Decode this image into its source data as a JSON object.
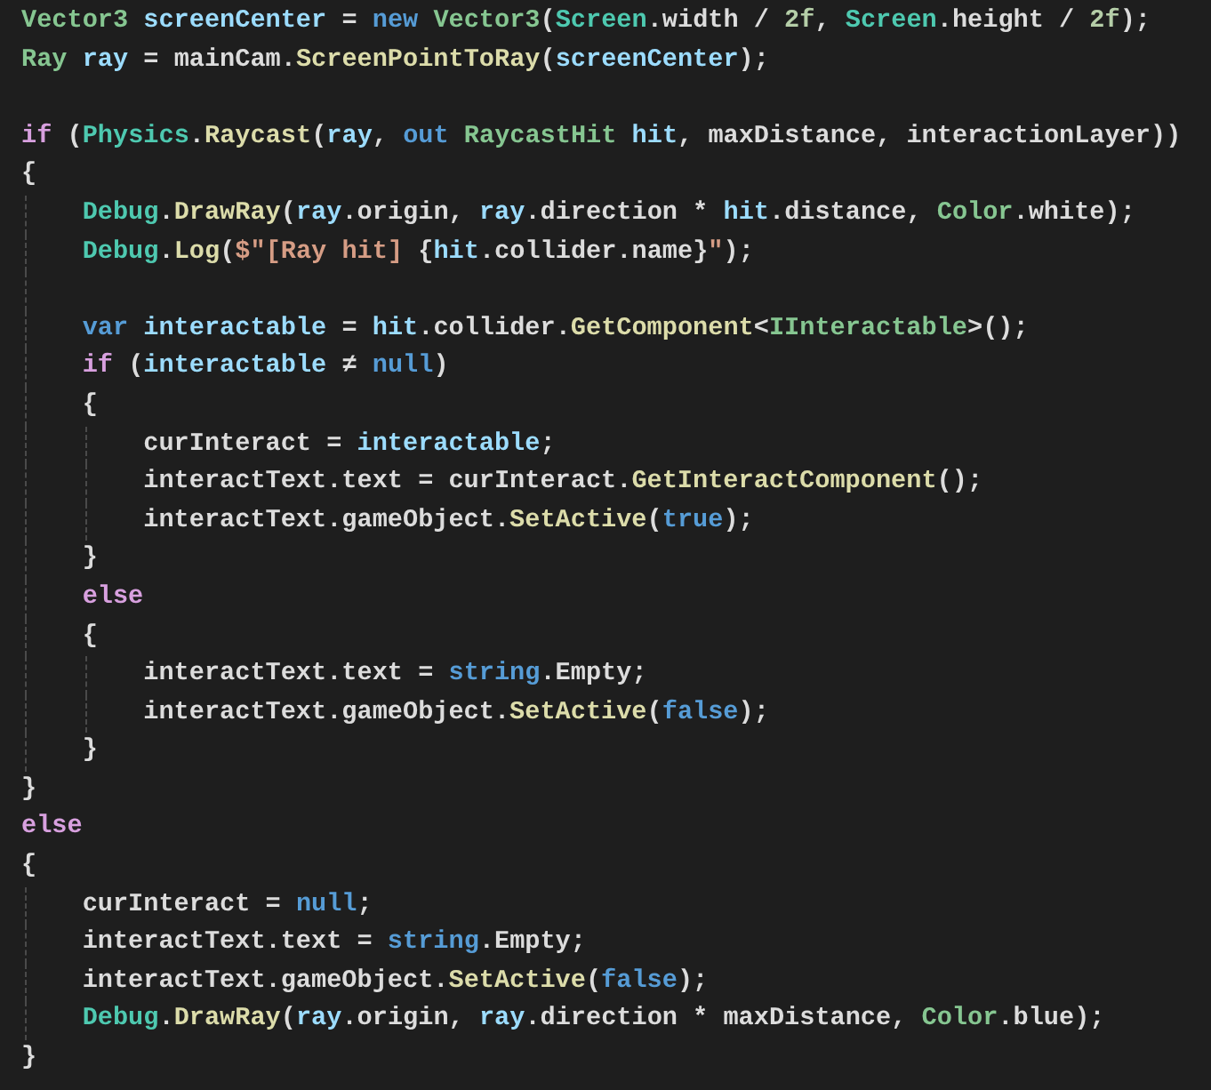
{
  "editor": {
    "lines": [
      {
        "kind": "code",
        "tokens": [
          {
            "text": "Vector3",
            "kind": "type"
          },
          {
            "text": " screenCenter",
            "kind": "local"
          },
          {
            "text": " = ",
            "kind": "plain"
          },
          {
            "text": "new",
            "kind": "keyword"
          },
          {
            "text": " Vector3",
            "kind": "type"
          },
          {
            "text": "(",
            "kind": "plain"
          },
          {
            "text": "Screen",
            "kind": "static"
          },
          {
            "text": ".width / ",
            "kind": "plain"
          },
          {
            "text": "2f",
            "kind": "number"
          },
          {
            "text": ", ",
            "kind": "plain"
          },
          {
            "text": "Screen",
            "kind": "static"
          },
          {
            "text": ".height / ",
            "kind": "plain"
          },
          {
            "text": "2f",
            "kind": "number"
          },
          {
            "text": ");",
            "kind": "plain"
          }
        ]
      },
      {
        "kind": "code",
        "tokens": [
          {
            "text": "Ray",
            "kind": "type"
          },
          {
            "text": " ray",
            "kind": "local"
          },
          {
            "text": " = mainCam.",
            "kind": "plain"
          },
          {
            "text": "ScreenPointToRay",
            "kind": "method"
          },
          {
            "text": "(",
            "kind": "plain"
          },
          {
            "text": "screenCenter",
            "kind": "local"
          },
          {
            "text": ");",
            "kind": "plain"
          }
        ]
      },
      {
        "kind": "blank"
      },
      {
        "kind": "code",
        "tokens": [
          {
            "text": "if",
            "kind": "control"
          },
          {
            "text": " (",
            "kind": "plain"
          },
          {
            "text": "Physics",
            "kind": "static"
          },
          {
            "text": ".",
            "kind": "plain"
          },
          {
            "text": "Raycast",
            "kind": "method"
          },
          {
            "text": "(",
            "kind": "plain"
          },
          {
            "text": "ray",
            "kind": "local"
          },
          {
            "text": ", ",
            "kind": "plain"
          },
          {
            "text": "out",
            "kind": "keyword"
          },
          {
            "text": " RaycastHit",
            "kind": "type"
          },
          {
            "text": " hit",
            "kind": "local"
          },
          {
            "text": ", maxDistance, interactionLayer))",
            "kind": "plain"
          }
        ]
      },
      {
        "kind": "code",
        "tokens": [
          {
            "text": "{",
            "kind": "plain"
          }
        ]
      },
      {
        "kind": "code",
        "tokens": [
          {
            "text": "    Debug",
            "kind": "static"
          },
          {
            "text": ".",
            "kind": "plain"
          },
          {
            "text": "DrawRay",
            "kind": "method"
          },
          {
            "text": "(",
            "kind": "plain"
          },
          {
            "text": "ray",
            "kind": "local"
          },
          {
            "text": ".origin, ",
            "kind": "plain"
          },
          {
            "text": "ray",
            "kind": "local"
          },
          {
            "text": ".direction * ",
            "kind": "plain"
          },
          {
            "text": "hit",
            "kind": "local"
          },
          {
            "text": ".distance, ",
            "kind": "plain"
          },
          {
            "text": "Color",
            "kind": "type"
          },
          {
            "text": ".white);",
            "kind": "plain"
          }
        ]
      },
      {
        "kind": "code",
        "tokens": [
          {
            "text": "    Debug",
            "kind": "static"
          },
          {
            "text": ".",
            "kind": "plain"
          },
          {
            "text": "Log",
            "kind": "method"
          },
          {
            "text": "(",
            "kind": "plain"
          },
          {
            "text": "$\"[Ray hit] ",
            "kind": "string"
          },
          {
            "text": "{",
            "kind": "plain"
          },
          {
            "text": "hit",
            "kind": "local"
          },
          {
            "text": ".collider.name}",
            "kind": "plain"
          },
          {
            "text": "\"",
            "kind": "string"
          },
          {
            "text": ");",
            "kind": "plain"
          }
        ]
      },
      {
        "kind": "blank"
      },
      {
        "kind": "code",
        "tokens": [
          {
            "text": "    var",
            "kind": "keyword"
          },
          {
            "text": " interactable",
            "kind": "local"
          },
          {
            "text": " = ",
            "kind": "plain"
          },
          {
            "text": "hit",
            "kind": "local"
          },
          {
            "text": ".collider.",
            "kind": "plain"
          },
          {
            "text": "GetComponent",
            "kind": "method"
          },
          {
            "text": "<",
            "kind": "plain"
          },
          {
            "text": "IInteractable",
            "kind": "type"
          },
          {
            "text": ">();",
            "kind": "plain"
          }
        ]
      },
      {
        "kind": "code",
        "tokens": [
          {
            "text": "    if",
            "kind": "control"
          },
          {
            "text": " (",
            "kind": "plain"
          },
          {
            "text": "interactable",
            "kind": "local"
          },
          {
            "text": " ≠ ",
            "kind": "plain"
          },
          {
            "text": "null",
            "kind": "keyword"
          },
          {
            "text": ")",
            "kind": "plain"
          }
        ]
      },
      {
        "kind": "code",
        "tokens": [
          {
            "text": "    {",
            "kind": "plain"
          }
        ]
      },
      {
        "kind": "code",
        "tokens": [
          {
            "text": "        curInteract = ",
            "kind": "plain"
          },
          {
            "text": "interactable",
            "kind": "local"
          },
          {
            "text": ";",
            "kind": "plain"
          }
        ]
      },
      {
        "kind": "code",
        "tokens": [
          {
            "text": "        interactText.text = curInteract.",
            "kind": "plain"
          },
          {
            "text": "GetInteractComponent",
            "kind": "method"
          },
          {
            "text": "();",
            "kind": "plain"
          }
        ]
      },
      {
        "kind": "code",
        "tokens": [
          {
            "text": "        interactText.gameObject.",
            "kind": "plain"
          },
          {
            "text": "SetActive",
            "kind": "method"
          },
          {
            "text": "(",
            "kind": "plain"
          },
          {
            "text": "true",
            "kind": "keyword"
          },
          {
            "text": ");",
            "kind": "plain"
          }
        ]
      },
      {
        "kind": "code",
        "tokens": [
          {
            "text": "    }",
            "kind": "plain"
          }
        ]
      },
      {
        "kind": "code",
        "tokens": [
          {
            "text": "    else",
            "kind": "control"
          }
        ]
      },
      {
        "kind": "code",
        "tokens": [
          {
            "text": "    {",
            "kind": "plain"
          }
        ]
      },
      {
        "kind": "code",
        "tokens": [
          {
            "text": "        interactText.text = ",
            "kind": "plain"
          },
          {
            "text": "string",
            "kind": "keyword"
          },
          {
            "text": ".Empty;",
            "kind": "plain"
          }
        ]
      },
      {
        "kind": "code",
        "tokens": [
          {
            "text": "        interactText.gameObject.",
            "kind": "plain"
          },
          {
            "text": "SetActive",
            "kind": "method"
          },
          {
            "text": "(",
            "kind": "plain"
          },
          {
            "text": "false",
            "kind": "keyword"
          },
          {
            "text": ");",
            "kind": "plain"
          }
        ]
      },
      {
        "kind": "code",
        "tokens": [
          {
            "text": "    }",
            "kind": "plain"
          }
        ]
      },
      {
        "kind": "code",
        "tokens": [
          {
            "text": "}",
            "kind": "plain"
          }
        ]
      },
      {
        "kind": "code",
        "tokens": [
          {
            "text": "else",
            "kind": "control"
          }
        ]
      },
      {
        "kind": "code",
        "tokens": [
          {
            "text": "{",
            "kind": "plain"
          }
        ]
      },
      {
        "kind": "code",
        "tokens": [
          {
            "text": "    curInteract = ",
            "kind": "plain"
          },
          {
            "text": "null",
            "kind": "keyword"
          },
          {
            "text": ";",
            "kind": "plain"
          }
        ]
      },
      {
        "kind": "code",
        "tokens": [
          {
            "text": "    interactText.text = ",
            "kind": "plain"
          },
          {
            "text": "string",
            "kind": "keyword"
          },
          {
            "text": ".Empty;",
            "kind": "plain"
          }
        ]
      },
      {
        "kind": "code",
        "tokens": [
          {
            "text": "    interactText.gameObject.",
            "kind": "plain"
          },
          {
            "text": "SetActive",
            "kind": "method"
          },
          {
            "text": "(",
            "kind": "plain"
          },
          {
            "text": "false",
            "kind": "keyword"
          },
          {
            "text": ");",
            "kind": "plain"
          }
        ]
      },
      {
        "kind": "code",
        "tokens": [
          {
            "text": "    Debug",
            "kind": "static"
          },
          {
            "text": ".",
            "kind": "plain"
          },
          {
            "text": "DrawRay",
            "kind": "method"
          },
          {
            "text": "(",
            "kind": "plain"
          },
          {
            "text": "ray",
            "kind": "local"
          },
          {
            "text": ".origin, ",
            "kind": "plain"
          },
          {
            "text": "ray",
            "kind": "local"
          },
          {
            "text": ".direction * maxDistance, ",
            "kind": "plain"
          },
          {
            "text": "Color",
            "kind": "type"
          },
          {
            "text": ".blue);",
            "kind": "plain"
          }
        ]
      },
      {
        "kind": "code",
        "tokens": [
          {
            "text": "}",
            "kind": "plain"
          }
        ]
      }
    ]
  }
}
